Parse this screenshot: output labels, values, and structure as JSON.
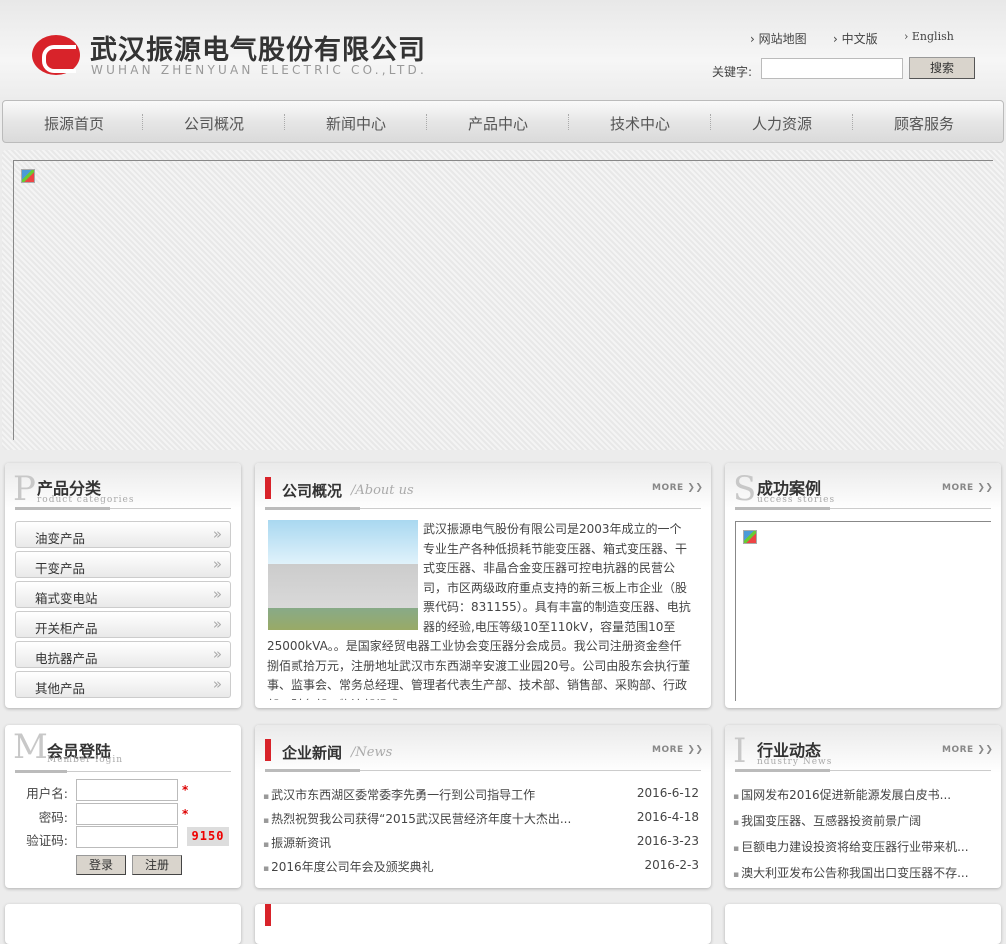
{
  "header": {
    "company_cn": "武汉振源电气股份有限公司",
    "company_en": "WUHAN ZHENYUAN ELECTRIC CO.,LTD.",
    "links": [
      "网站地图",
      "中文版",
      "English"
    ],
    "keyword_label": "关键字:",
    "keyword_value": "",
    "search_label": "搜索"
  },
  "nav": [
    "振源首页",
    "公司概况",
    "新闻中心",
    "产品中心",
    "技术中心",
    "人力资源",
    "顾客服务"
  ],
  "products": {
    "letter": "P",
    "title": "产品分类",
    "subtitle": "roduct categories",
    "items": [
      "油变产品",
      "干变产品",
      "箱式变电站",
      "开关柜产品",
      "电抗器产品",
      "其他产品"
    ]
  },
  "about": {
    "title": "公司概况",
    "subtitle": "/About us",
    "more": "MORE",
    "text": "武汉振源电气股份有限公司是2003年成立的一个专业生产各种低损耗节能变压器、箱式变压器、干式变压器、非晶合金变压器可控电抗器的民营公司，市区两级政府重点支持的新三板上市企业（股票代码：831155）。具有丰富的制造变压器、电抗器的经验,电压等级10至110kV，容量范围10至25000kVA。。是国家经贸电器工业协会变压器分会成员。我公司注册资金叁仟捌佰贰拾万元，注册地址武汉市东西湖辛安渡工业园20号。公司由股东会执行董事、监事会、常务总经理、管理者代表生产部、技术部、销售部、采购部、行政部、财务部、物流部组成。"
  },
  "cases": {
    "letter": "S",
    "title": "成功案例",
    "subtitle": "uccess stories",
    "more": "MORE"
  },
  "login": {
    "letter": "M",
    "title": "会员登陆",
    "subtitle": "Member login",
    "username_label": "用户名:",
    "password_label": "密码:",
    "captcha_label": "验证码:",
    "required": "*",
    "captcha": "9150",
    "login_label": "登录",
    "register_label": "注册"
  },
  "news": {
    "title": "企业新闻",
    "subtitle": "/News",
    "more": "MORE",
    "items": [
      {
        "title": "武汉市东西湖区委常委李先勇一行到公司指导工作",
        "date": "2016-6-12"
      },
      {
        "title": "热烈祝贺我公司获得“2015武汉民营经济年度十大杰出...",
        "date": "2016-4-18"
      },
      {
        "title": "振源新资讯",
        "date": "2016-3-23"
      },
      {
        "title": "2016年度公司年会及颁奖典礼",
        "date": "2016-2-3"
      }
    ]
  },
  "industry": {
    "letter": "I",
    "title": "行业动态",
    "subtitle": "ndustry News",
    "more": "MORE",
    "items": [
      "国网发布2016促进新能源发展白皮书...",
      "我国变压器、互感器投资前景广阔",
      "巨额电力建设投资将给变压器行业带来机...",
      "澳大利亚发布公告称我国出口变压器不存..."
    ]
  }
}
